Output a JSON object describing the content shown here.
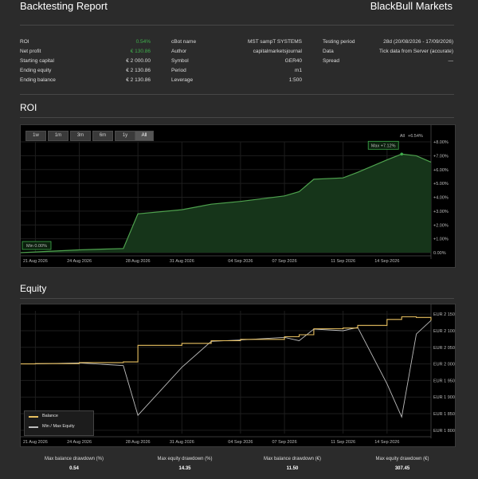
{
  "header": {
    "title": "Backtesting Report",
    "broker": "BlackBull Markets"
  },
  "summary": {
    "col1": [
      {
        "label": "ROI",
        "value": "0.54%",
        "green": true
      },
      {
        "label": "Net profit",
        "value": "€ 130.86",
        "green": true
      },
      {
        "label": "Starting capital",
        "value": "€ 2 000.00"
      },
      {
        "label": "Ending equity",
        "value": "€ 2 130.86"
      },
      {
        "label": "Ending balance",
        "value": "€ 2 130.86"
      }
    ],
    "col2": [
      {
        "label": "cBot name",
        "value": "MST sampT SYSTEMS"
      },
      {
        "label": "Author",
        "value": "capitalmarketsjournal"
      },
      {
        "label": "Symbol",
        "value": "GER40"
      },
      {
        "label": "Period",
        "value": "m1"
      },
      {
        "label": "Leverage",
        "value": "1:500"
      }
    ],
    "col3": [
      {
        "label": "Testing period",
        "value": "28d (20/08/2026 - 17/09/2026)"
      },
      {
        "label": "Data",
        "value": "Tick data from Server (accurate)"
      },
      {
        "label": "Spread",
        "value": "—"
      }
    ]
  },
  "roi_section": {
    "title": "ROI"
  },
  "equity_section": {
    "title": "Equity"
  },
  "timeframes": [
    "1w",
    "1m",
    "3m",
    "6m",
    "1y",
    "All"
  ],
  "selected_timeframe": "All",
  "roi_legend": {
    "label": "All",
    "value": "+6.54%"
  },
  "roi_min_label": "Min 0.00%",
  "roi_max_label": "Max +7.12%",
  "x_ticks": [
    "21 Aug 2026",
    "24 Aug 2026",
    "28 Aug 2026",
    "31 Aug 2026",
    "04 Sep 2026",
    "07 Sep 2026",
    "11 Sep 2026",
    "14 Sep 2026"
  ],
  "roi_y_ticks": [
    "+8.00%",
    "+7.00%",
    "+6.00%",
    "+5.00%",
    "+4.00%",
    "+3.00%",
    "+2.00%",
    "+1.00%",
    "0.00%"
  ],
  "equity_y_ticks": [
    "EUR 2 150.00",
    "EUR 2 100.00",
    "EUR 2 050.00",
    "EUR 2 000.00",
    "EUR 1 950.00",
    "EUR 1 900.00",
    "EUR 1 850.00",
    "EUR 1 800.00"
  ],
  "equity_legend": [
    "Balance",
    "Min / Max Equity"
  ],
  "colors": {
    "roi_line": "#4ea24e",
    "roi_fill": "#16351a",
    "balance": "#e8c060",
    "equity": "#bdbdbd",
    "accent": "#3fae4c"
  },
  "chart_data": [
    {
      "type": "area",
      "title": "ROI",
      "x": [
        "20 Aug 2026",
        "21 Aug 2026",
        "24 Aug 2026",
        "27 Aug 2026",
        "28 Aug 2026",
        "31 Aug 2026",
        "02 Sep 2026",
        "04 Sep 2026",
        "07 Sep 2026",
        "08 Sep 2026",
        "09 Sep 2026",
        "11 Sep 2026",
        "12 Sep 2026",
        "14 Sep 2026",
        "15 Sep 2026",
        "16 Sep 2026",
        "17 Sep 2026"
      ],
      "series": [
        {
          "values": [
            0.0,
            0.05,
            0.2,
            0.3,
            2.8,
            3.1,
            3.5,
            3.7,
            4.1,
            4.4,
            5.3,
            5.4,
            5.8,
            6.7,
            7.12,
            7.0,
            6.54
          ]
        }
      ],
      "ylim": [
        0,
        8
      ],
      "min_label": "Min 0.00%",
      "max_label": "Max +7.12%",
      "legend": "All +6.54%"
    },
    {
      "type": "line",
      "title": "Equity",
      "x": [
        "20 Aug 2026",
        "21 Aug 2026",
        "24 Aug 2026",
        "27 Aug 2026",
        "28 Aug 2026",
        "31 Aug 2026",
        "02 Sep 2026",
        "04 Sep 2026",
        "07 Sep 2026",
        "08 Sep 2026",
        "09 Sep 2026",
        "11 Sep 2026",
        "12 Sep 2026",
        "14 Sep 2026",
        "15 Sep 2026",
        "16 Sep 2026",
        "17 Sep 2026"
      ],
      "series": [
        {
          "name": "Balance",
          "values": [
            2000,
            2001,
            2004,
            2006,
            2056,
            2062,
            2070,
            2074,
            2082,
            2088,
            2106,
            2108,
            2116,
            2134,
            2142,
            2140,
            2131
          ]
        },
        {
          "name": "Min / Max Equity",
          "values": [
            2000,
            2000,
            2003,
            1995,
            1845,
            1990,
            2068,
            2072,
            2080,
            2070,
            2105,
            2100,
            2110,
            1940,
            1840,
            2090,
            2131
          ]
        }
      ],
      "ylim": [
        1790,
        2160
      ],
      "legend_position": "bottom-left"
    }
  ],
  "footer": [
    {
      "label": "Max balance drawdown (%)",
      "value": "0.54"
    },
    {
      "label": "Max equity drawdown (%)",
      "value": "14.35"
    },
    {
      "label": "Max balance drawdown (€)",
      "value": "11.50"
    },
    {
      "label": "Max equity drawdown (€)",
      "value": "307.45"
    }
  ]
}
